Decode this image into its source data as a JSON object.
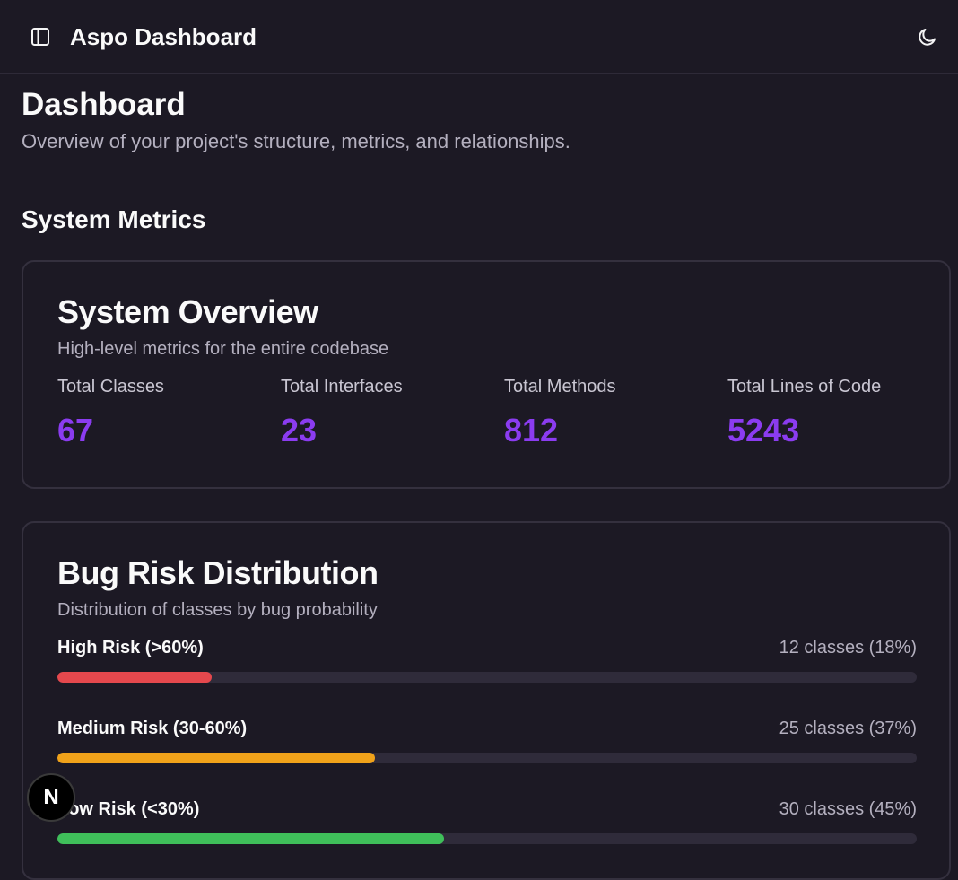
{
  "header": {
    "title": "Aspo Dashboard",
    "sidebar_toggle_icon": "panel-left-icon",
    "theme_toggle_icon": "moon-icon"
  },
  "page": {
    "title": "Dashboard",
    "subtitle": "Overview of your project's structure, metrics, and relationships."
  },
  "section": {
    "title": "System Metrics"
  },
  "overview": {
    "title": "System Overview",
    "description": "High-level metrics for the entire codebase",
    "accent_color": "#8b3cf0",
    "metrics": [
      {
        "label": "Total Classes",
        "value": "67"
      },
      {
        "label": "Total Interfaces",
        "value": "23"
      },
      {
        "label": "Total Methods",
        "value": "812"
      },
      {
        "label": "Total Lines of Code",
        "value": "5243"
      }
    ]
  },
  "risk": {
    "title": "Bug Risk Distribution",
    "description": "Distribution of classes by bug probability",
    "rows": [
      {
        "label": "High Risk (>60%)",
        "count": "12 classes (18%)",
        "percent": 18,
        "color": "#e5484d"
      },
      {
        "label": "Medium Risk (30-60%)",
        "count": "25 classes (37%)",
        "percent": 37,
        "color": "#f0a21a"
      },
      {
        "label": "Low Risk (<30%)",
        "count": "30 classes (45%)",
        "percent": 45,
        "color": "#3fbf5a"
      }
    ]
  },
  "badge": {
    "letter": "N"
  }
}
